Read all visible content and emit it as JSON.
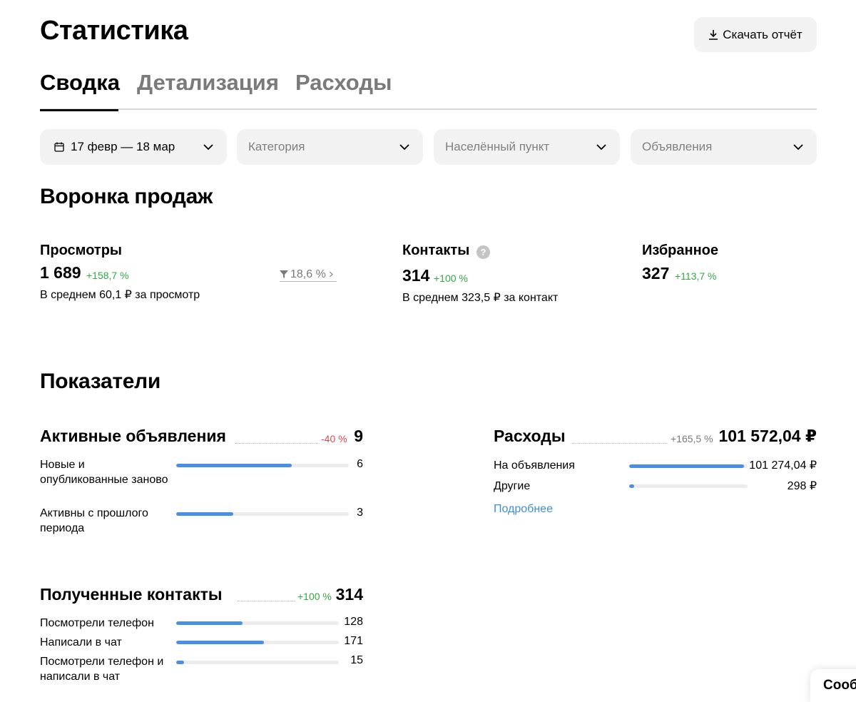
{
  "header": {
    "title": "Статистика",
    "download_label": "Скачать отчёт"
  },
  "tabs": [
    {
      "label": "Сводка",
      "active": true
    },
    {
      "label": "Детализация",
      "active": false
    },
    {
      "label": "Расходы",
      "active": false
    }
  ],
  "filters": {
    "date": "17 февр — 18 мар",
    "category_placeholder": "Категория",
    "city_placeholder": "Населённый пункт",
    "ads_placeholder": "Объявления"
  },
  "funnel": {
    "title": "Воронка продаж",
    "views": {
      "title": "Просмотры",
      "value": "1 689",
      "delta": "+158,7 %",
      "subtext": "В среднем 60,1 ₽ за просмотр"
    },
    "conversion": "18,6 %",
    "contacts": {
      "title": "Контакты",
      "help": "?",
      "value": "314",
      "delta": "+100 %",
      "subtext": "В среднем 323,5 ₽ за контакт"
    },
    "favorites": {
      "title": "Избранное",
      "value": "327",
      "delta": "+113,7 %"
    }
  },
  "indicators": {
    "title": "Показатели",
    "active_ads": {
      "title": "Активные объявления",
      "delta": "-40 %",
      "total": "9",
      "rows": [
        {
          "label": "Новые и опубликованные заново",
          "value": "6",
          "fill": 0.67
        },
        {
          "label": "Активны с прошлого периода",
          "value": "3",
          "fill": 0.33
        }
      ]
    },
    "expenses": {
      "title": "Расходы",
      "delta": "+165,5 %",
      "total": "101 572,04 ₽",
      "rows": [
        {
          "label": "На объявления",
          "value": "101 274,04 ₽",
          "fill": 0.97
        },
        {
          "label": "Другие",
          "value": "298 ₽",
          "fill": 0.04
        }
      ],
      "more_link": "Подробнее"
    },
    "contacts": {
      "title": "Полученные контакты",
      "delta": "+100 %",
      "total": "314",
      "rows": [
        {
          "label": "Посмотрели телефон",
          "value": "128",
          "fill": 0.41
        },
        {
          "label": "Написали в чат",
          "value": "171",
          "fill": 0.54
        },
        {
          "label": "Посмотрели телефон и написали в чат",
          "value": "15",
          "fill": 0.05
        }
      ]
    }
  },
  "chat": {
    "label": "Сообщения"
  },
  "colors": {
    "accent_bar": "#4a90e2",
    "positive": "#33a842",
    "negative": "#e5484d",
    "link": "#3d8fd6"
  }
}
